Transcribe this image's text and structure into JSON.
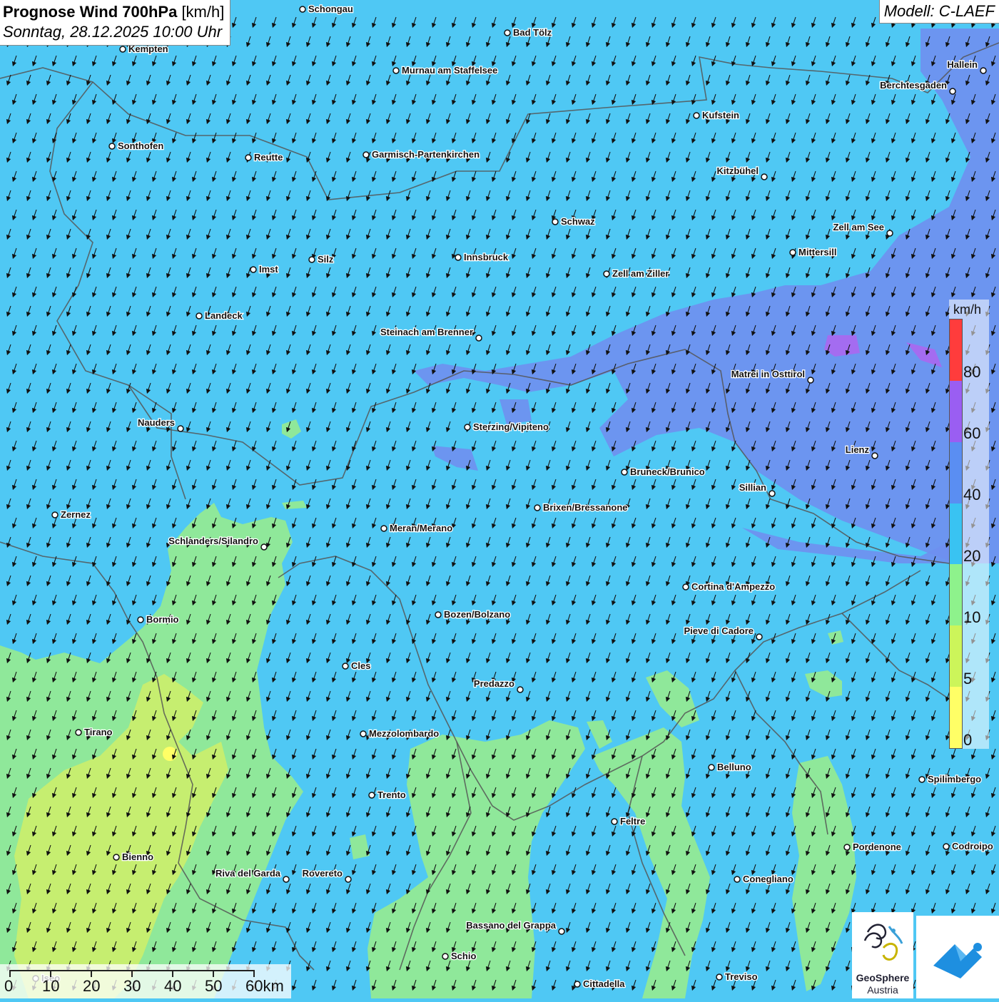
{
  "header": {
    "title_bold": "Prognose Wind 700hPa",
    "title_unit": "[km/h]",
    "datetime": "Sonntag, 28.12.2025 10:00 Uhr",
    "model": "Modell: C-LAEF"
  },
  "map": {
    "wind_arrow_direction": "from north-northeast (arrows pointing south-southwest)",
    "cities": [
      {
        "name": "Schongau"
      },
      {
        "name": "Bad Tölz"
      },
      {
        "name": "Kempten"
      },
      {
        "name": "Hallein"
      },
      {
        "name": "Murnau am Staffelsee"
      },
      {
        "name": "Berchtesgaden"
      },
      {
        "name": "Kufstein"
      },
      {
        "name": "Sonthofen"
      },
      {
        "name": "Reutte"
      },
      {
        "name": "Garmisch-Partenkirchen"
      },
      {
        "name": "Kitzbühel"
      },
      {
        "name": "Schwaz"
      },
      {
        "name": "Zell am See"
      },
      {
        "name": "Mittersill"
      },
      {
        "name": "Silz"
      },
      {
        "name": "Innsbruck"
      },
      {
        "name": "Imst"
      },
      {
        "name": "Zell am Ziller"
      },
      {
        "name": "Landeck"
      },
      {
        "name": "Steinach am Brenner"
      },
      {
        "name": "Matrei in Osttirol"
      },
      {
        "name": "Nauders"
      },
      {
        "name": "Sterzing/Vipiteno"
      },
      {
        "name": "Lienz"
      },
      {
        "name": "Bruneck/Brunico"
      },
      {
        "name": "Sillian"
      },
      {
        "name": "Brixen/Bressanone"
      },
      {
        "name": "Zernez"
      },
      {
        "name": "Meran/Merano"
      },
      {
        "name": "Schlanders/Silandro"
      },
      {
        "name": "Cortina d'Ampezzo"
      },
      {
        "name": "Bozen/Bolzano"
      },
      {
        "name": "Bormio"
      },
      {
        "name": "Pieve di Cadore"
      },
      {
        "name": "Cles"
      },
      {
        "name": "Predazzo"
      },
      {
        "name": "Tirano"
      },
      {
        "name": "Mezzolombardo"
      },
      {
        "name": "Belluno"
      },
      {
        "name": "Spilimbergo"
      },
      {
        "name": "Trento"
      },
      {
        "name": "Feltre"
      },
      {
        "name": "Pordenone"
      },
      {
        "name": "Codroipo"
      },
      {
        "name": "Bienno"
      },
      {
        "name": "Riva del Garda"
      },
      {
        "name": "Rovereto"
      },
      {
        "name": "Conegliano"
      },
      {
        "name": "Bassano del Grappa"
      },
      {
        "name": "Schio"
      },
      {
        "name": "Treviso"
      },
      {
        "name": "Cittadella"
      },
      {
        "name": "Iseo"
      }
    ]
  },
  "legend": {
    "unit": "km/h",
    "ticks": [
      "0",
      "5",
      "10",
      "20",
      "40",
      "60",
      "80"
    ],
    "colors": [
      "#ffff66",
      "#ccf55a",
      "#8ef28c",
      "#39c3f2",
      "#5a8ef2",
      "#9a5ef2",
      "#ff3c3c"
    ]
  },
  "scalebar": {
    "labels": [
      "0",
      "10",
      "20",
      "30",
      "40",
      "50",
      "60km"
    ]
  },
  "logos": {
    "geosphere_name": "GeoSphere",
    "geosphere_sub": "Austria"
  },
  "colors": {
    "wind_20_40": "#4fc8f4",
    "wind_40_60": "#6f8ff0",
    "wind_60_80": "#9b6fee",
    "wind_10_20": "#8fe89a",
    "wind_5_10": "#c9ee6e",
    "borders": "#555555"
  }
}
